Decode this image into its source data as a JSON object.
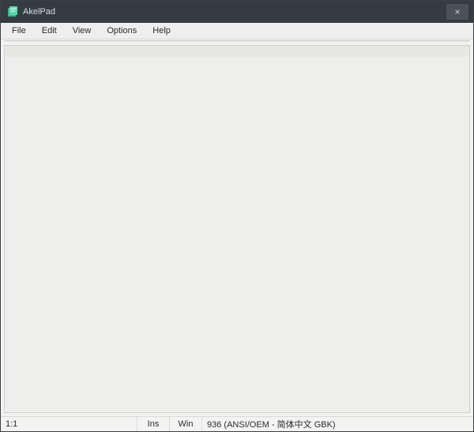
{
  "window": {
    "title": "AkelPad"
  },
  "menu": {
    "file": "File",
    "edit": "Edit",
    "view": "View",
    "options": "Options",
    "help": "Help"
  },
  "editor": {
    "content": ""
  },
  "status": {
    "position": "1:1",
    "insert_mode": "Ins",
    "eol": "Win",
    "encoding": "936  (ANSI/OEM - 简体中文 GBK)"
  }
}
